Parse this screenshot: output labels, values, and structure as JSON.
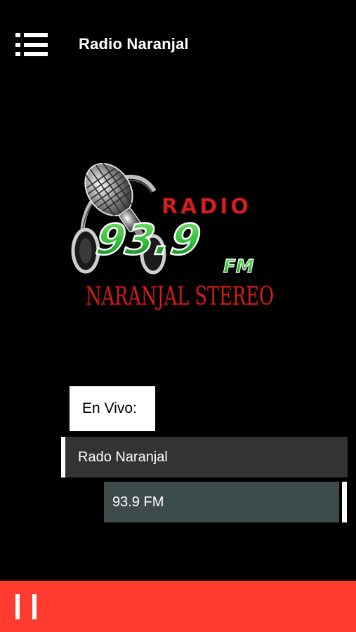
{
  "header": {
    "title": "Radio Naranjal",
    "menu_icon": "list-menu-icon"
  },
  "logo": {
    "top_word": "RADIO",
    "frequency": "93.9",
    "band": "FM",
    "station_text": "NARANJAL STEREO",
    "icon": "microphone-headphones-icon",
    "colors": {
      "red": "#d8201c",
      "green": "#2fbe3a",
      "green_dark": "#0c6d1a"
    }
  },
  "now_playing": {
    "label": "En Vivo:",
    "station": "Rado Naranjal",
    "frequency": "93.9 FM"
  },
  "player": {
    "state": "playing",
    "control_icon": "pause-icon",
    "bar_color": "#ff3b30"
  }
}
